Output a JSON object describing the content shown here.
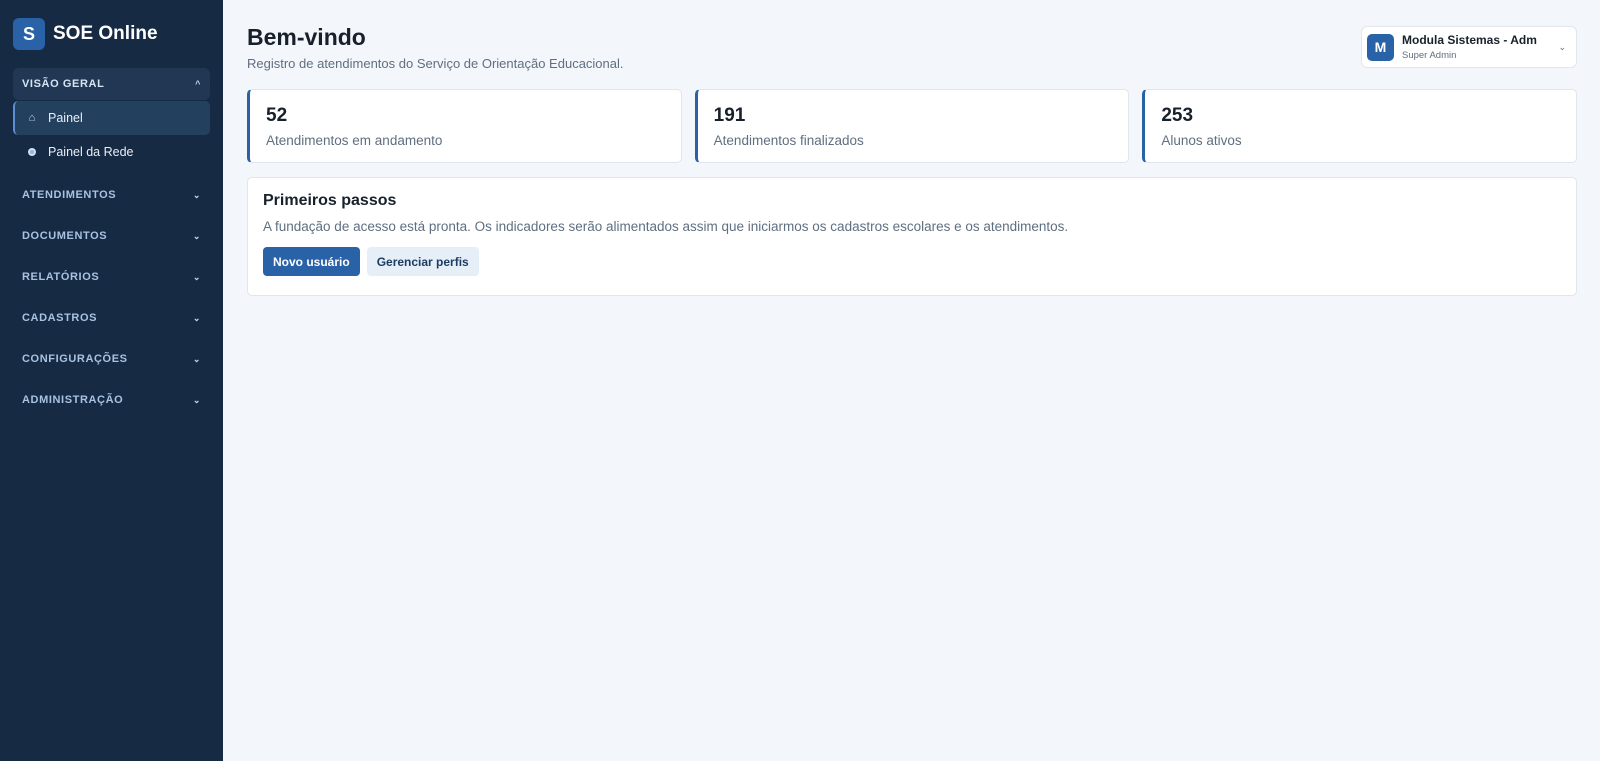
{
  "brand": {
    "logo_letter": "S",
    "name": "SOE Online"
  },
  "sidebar": {
    "groups": [
      {
        "label": "VISÃO GERAL",
        "open": true,
        "caret": "^",
        "items": [
          {
            "label": "Painel",
            "icon": "home-icon",
            "glyph": "⌂",
            "active": true
          },
          {
            "label": "Painel da Rede",
            "icon": "radio-dot-icon",
            "active": false
          }
        ]
      },
      {
        "label": "ATENDIMENTOS",
        "open": false,
        "caret": "⌄"
      },
      {
        "label": "DOCUMENTOS",
        "open": false,
        "caret": "⌄"
      },
      {
        "label": "RELATÓRIOS",
        "open": false,
        "caret": "⌄"
      },
      {
        "label": "CADASTROS",
        "open": false,
        "caret": "⌄"
      },
      {
        "label": "CONFIGURAÇÕES",
        "open": false,
        "caret": "⌄"
      },
      {
        "label": "ADMINISTRAÇÃO",
        "open": false,
        "caret": "⌄"
      }
    ]
  },
  "header": {
    "title": "Bem-vindo",
    "subtitle": "Registro de atendimentos do Serviço de Orientação Educacional."
  },
  "user": {
    "avatar_letter": "M",
    "name": "Modula Sistemas - Adm",
    "role": "Super Admin",
    "caret": "⌄"
  },
  "stats": [
    {
      "value": "52",
      "label": "Atendimentos em andamento"
    },
    {
      "value": "191",
      "label": "Atendimentos finalizados"
    },
    {
      "value": "253",
      "label": "Alunos ativos"
    }
  ],
  "getting_started": {
    "title": "Primeiros passos",
    "text": "A fundação de acesso está pronta. Os indicadores serão alimentados assim que iniciarmos os cadastros escolares e os atendimentos.",
    "primary_button": "Novo usuário",
    "secondary_button": "Gerenciar perfis"
  },
  "colors": {
    "sidebar_bg": "#172a44",
    "accent": "#2a62a8",
    "page_bg": "#f3f6fa"
  }
}
